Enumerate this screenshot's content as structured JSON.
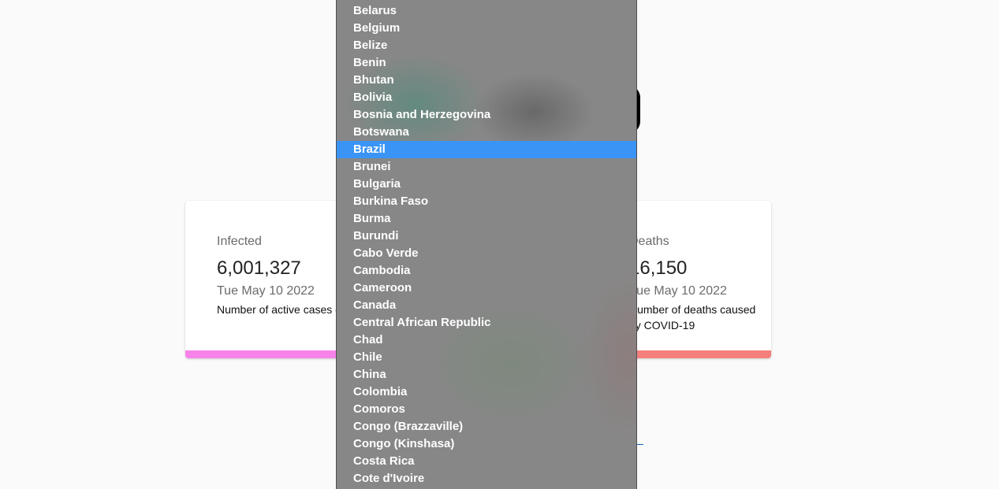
{
  "colors": {
    "infected_bar": "#f783ea",
    "deaths_bar": "#f47f7c",
    "selected_option": "#3a94f6",
    "dropdown_bg": "#878787"
  },
  "cards": {
    "infected": {
      "label": "Infected",
      "count": "6,001,327",
      "date": "Tue May 10 2022",
      "description": "Number of active cases of COVID-19"
    },
    "deaths": {
      "label": "Deaths",
      "count": "16,150",
      "date": "Tue May 10 2022",
      "description": "Number of deaths caused by COVID-19"
    }
  },
  "country_select": {
    "selected": "Brazil",
    "options": [
      "Belarus",
      "Belgium",
      "Belize",
      "Benin",
      "Bhutan",
      "Bolivia",
      "Bosnia and Herzegovina",
      "Botswana",
      "Brazil",
      "Brunei",
      "Bulgaria",
      "Burkina Faso",
      "Burma",
      "Burundi",
      "Cabo Verde",
      "Cambodia",
      "Cameroon",
      "Canada",
      "Central African Republic",
      "Chad",
      "Chile",
      "China",
      "Colombia",
      "Comoros",
      "Congo (Brazzaville)",
      "Congo (Kinshasa)",
      "Costa Rica",
      "Cote d'Ivoire"
    ]
  }
}
